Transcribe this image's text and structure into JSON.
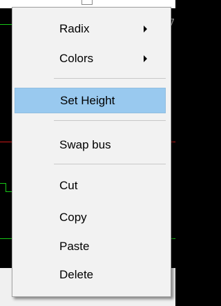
{
  "menu": {
    "items": [
      {
        "label": "Radix",
        "submenu": true
      },
      {
        "label": "Colors",
        "submenu": true
      },
      {
        "label": "Set Height",
        "highlighted": true
      },
      {
        "label": "Swap bus"
      },
      {
        "label": "Cut"
      },
      {
        "label": "Copy"
      },
      {
        "label": "Paste"
      },
      {
        "label": "Delete"
      }
    ]
  },
  "background": {
    "edge_digit": "7"
  },
  "colors": {
    "highlight": "#99c9ef",
    "wave_green": "#17c817",
    "wave_red": "#d01818"
  }
}
